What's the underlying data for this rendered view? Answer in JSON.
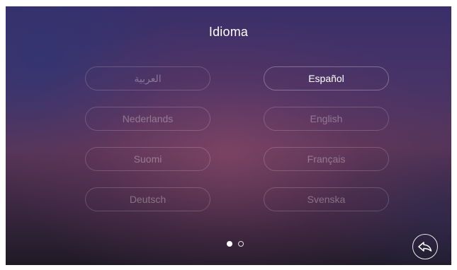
{
  "header": {
    "title": "Idioma"
  },
  "languages": [
    {
      "label": "العربية",
      "selected": false
    },
    {
      "label": "Español",
      "selected": true
    },
    {
      "label": "Nederlands",
      "selected": false
    },
    {
      "label": "English",
      "selected": false
    },
    {
      "label": "Suomi",
      "selected": false
    },
    {
      "label": "Français",
      "selected": false
    },
    {
      "label": "Deutsch",
      "selected": false
    },
    {
      "label": "Svenska",
      "selected": false
    }
  ],
  "pagination": {
    "current_page": 1,
    "total_pages": 2
  },
  "back_button": {
    "icon": "return-arrow-icon"
  }
}
